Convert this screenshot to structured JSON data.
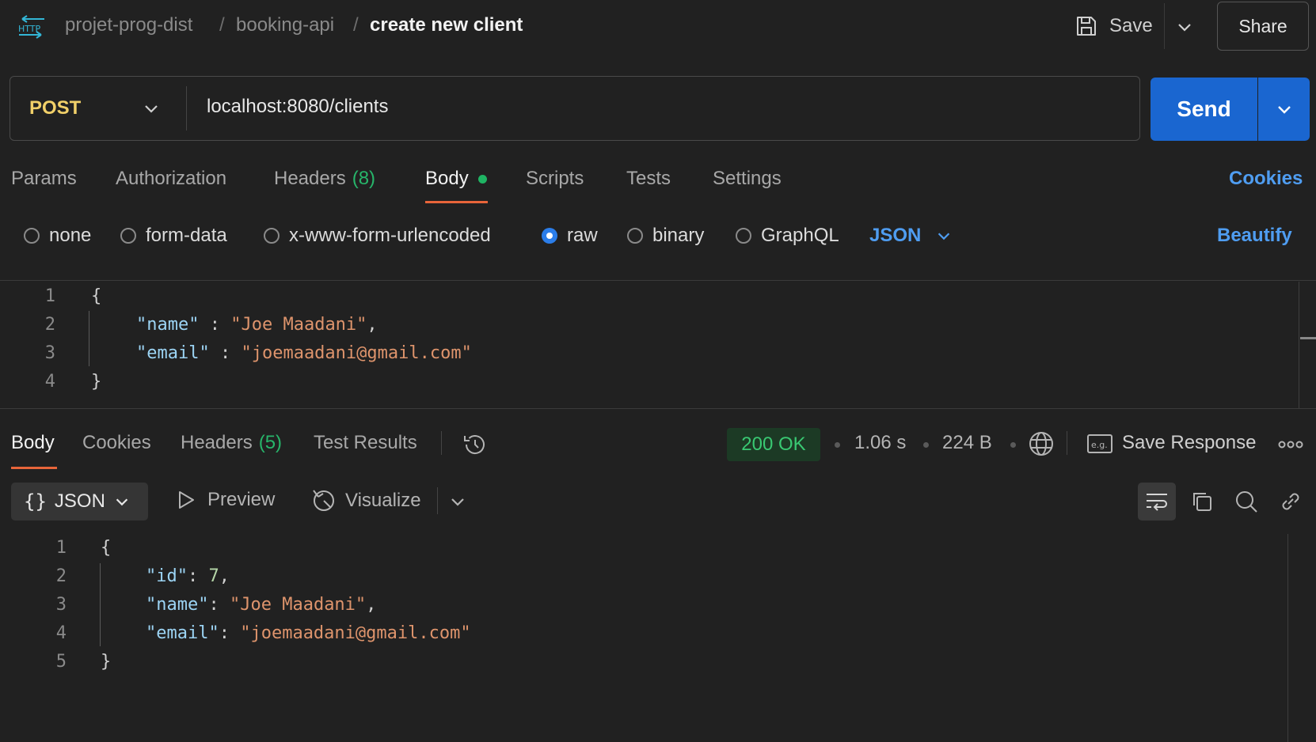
{
  "header": {
    "protocol_icon": "http-icon",
    "breadcrumb": [
      "projet-prog-dist",
      "booking-api",
      "create new client"
    ],
    "save_label": "Save",
    "share_label": "Share"
  },
  "request": {
    "method": "POST",
    "url": "localhost:8080/clients",
    "send_label": "Send"
  },
  "request_tabs": {
    "params": "Params",
    "authorization": "Authorization",
    "headers": "Headers",
    "headers_count": "(8)",
    "body": "Body",
    "scripts": "Scripts",
    "tests": "Tests",
    "settings": "Settings",
    "cookies": "Cookies",
    "active": "Body"
  },
  "body_types": {
    "options": [
      "none",
      "form-data",
      "x-www-form-urlencoded",
      "raw",
      "binary",
      "GraphQL"
    ],
    "selected": "raw",
    "language": "JSON",
    "beautify": "Beautify"
  },
  "request_body": {
    "line_numbers": [
      "1",
      "2",
      "3",
      "4"
    ],
    "open_brace": "{",
    "name_key": "\"name\"",
    "name_sep": " : ",
    "name_value": "\"Joe Maadani\"",
    "email_key": "\"email\"",
    "email_sep": " : ",
    "email_value": "\"joemaadani@gmail.com\"",
    "close_brace": "}"
  },
  "response_tabs": {
    "body": "Body",
    "cookies": "Cookies",
    "headers": "Headers",
    "headers_count": "(5)",
    "test_results": "Test Results",
    "active": "Body"
  },
  "response_meta": {
    "status": "200 OK",
    "time": "1.06 s",
    "size": "224 B",
    "save_response": "Save Response",
    "status_color": "#39c872"
  },
  "response_toolbar": {
    "format": "JSON",
    "preview": "Preview",
    "visualize": "Visualize"
  },
  "response_body": {
    "line_numbers": [
      "1",
      "2",
      "3",
      "4",
      "5"
    ],
    "open_brace": "{",
    "id_key": "\"id\"",
    "id_value": "7",
    "name_key": "\"name\"",
    "name_value": "\"Joe Maadani\"",
    "email_key": "\"email\"",
    "email_value": "\"joemaadani@gmail.com\"",
    "close_brace": "}"
  },
  "colors": {
    "accent_blue": "#1a66d0",
    "method_post": "#f1d069",
    "active_tab_underline": "#e8653a",
    "link_blue": "#4f9df1"
  }
}
